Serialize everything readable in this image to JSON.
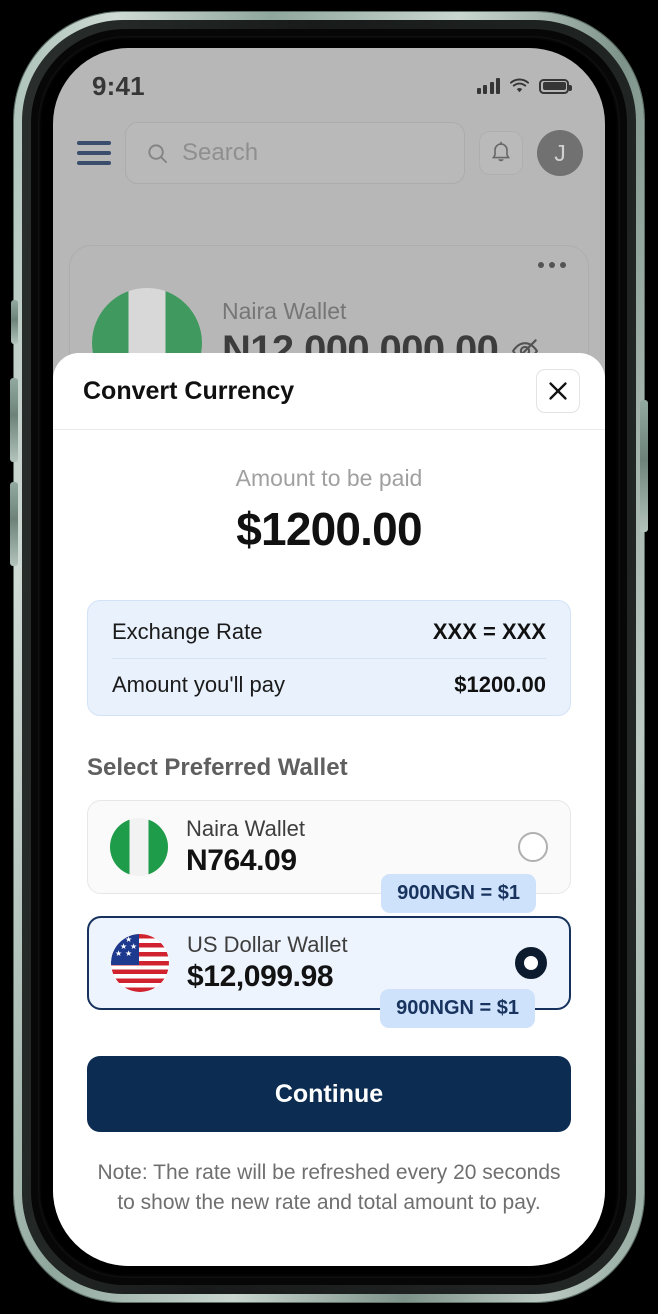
{
  "status_bar": {
    "time": "9:41",
    "signal_icon": "cellular-bars-icon",
    "wifi_icon": "wifi-icon",
    "battery_icon": "battery-full-icon"
  },
  "header": {
    "menu_icon": "hamburger-menu-icon",
    "search": {
      "placeholder": "Search",
      "icon": "search-icon"
    },
    "notification_icon": "bell-icon",
    "avatar_initial": "J"
  },
  "background_card": {
    "label": "Naira Wallet",
    "amount": "N12,000,000.00",
    "more_icon": "more-options-icon",
    "visibility_icon": "eye-off-icon",
    "flag": "nigeria-flag-icon"
  },
  "modal": {
    "title": "Convert Currency",
    "close_icon": "close-icon",
    "amount_label": "Amount to be paid",
    "amount_value": "$1200.00",
    "rate_rows": [
      {
        "key": "Exchange Rate",
        "value": "XXX = XXX"
      },
      {
        "key": "Amount you'll pay",
        "value": "$1200.00"
      }
    ],
    "section_title": "Select Preferred Wallet",
    "wallets": [
      {
        "name": "Naira Wallet",
        "balance": "N764.09",
        "rate_badge": "900NGN = $1",
        "selected": false,
        "flag": "nigeria-flag-icon"
      },
      {
        "name": "US Dollar Wallet",
        "balance": "$12,099.98",
        "rate_badge": "900NGN = $1",
        "selected": true,
        "flag": "usa-flag-icon"
      }
    ],
    "continue_label": "Continue",
    "note": "Note: The rate will be refreshed every 20 seconds to show the new rate and total amount to pay."
  },
  "colors": {
    "primary_navy": "#0d2c52",
    "info_bg": "#e8f1fc",
    "badge_bg": "#cfe2fb",
    "selected_border": "#16325c"
  }
}
